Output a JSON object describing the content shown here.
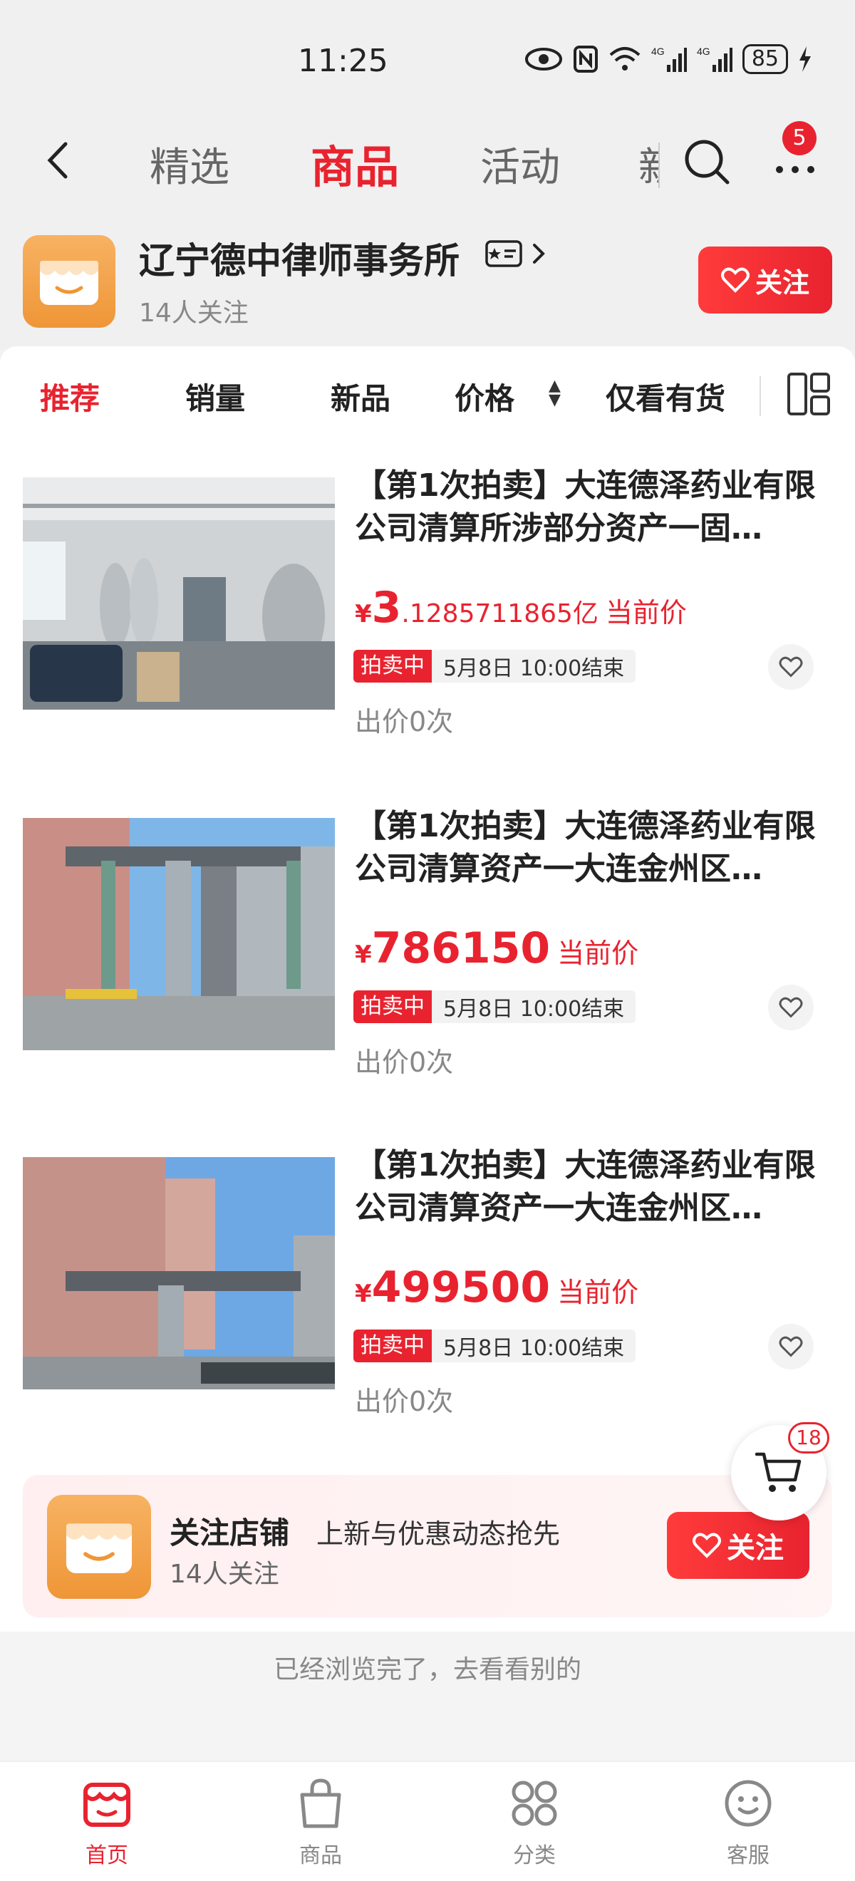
{
  "status_bar": {
    "time": "11:25",
    "battery": "85"
  },
  "top_nav": {
    "tabs": [
      {
        "label": "精选"
      },
      {
        "label": "商品"
      },
      {
        "label": "活动"
      },
      {
        "label": "新"
      }
    ],
    "more_badge": "5"
  },
  "shop": {
    "name": "辽宁德中律师事务所",
    "followers": "14人关注",
    "follow_label": "关注"
  },
  "filters": {
    "items": [
      "推荐",
      "销量",
      "新品",
      "价格",
      "仅看有货"
    ]
  },
  "products": [
    {
      "title": "【第1次拍卖】大连德泽药业有限公司清算所涉部分资产一固…",
      "price_symbol": "¥",
      "price_main": "3",
      "price_rest": ".1285711865亿",
      "price_label": "当前价",
      "status_tag": "拍卖中",
      "end_time": "5月8日 10:00结束",
      "bids": "出价0次"
    },
    {
      "title": "【第1次拍卖】大连德泽药业有限公司清算资产一大连金州区…",
      "price_symbol": "¥",
      "price_main": "786150",
      "price_rest": "",
      "price_label": "当前价",
      "status_tag": "拍卖中",
      "end_time": "5月8日 10:00结束",
      "bids": "出价0次"
    },
    {
      "title": "【第1次拍卖】大连德泽药业有限公司清算资产一大连金州区…",
      "price_symbol": "¥",
      "price_main": "499500",
      "price_rest": "",
      "price_label": "当前价",
      "status_tag": "拍卖中",
      "end_time": "5月8日 10:00结束",
      "bids": "出价0次"
    }
  ],
  "cart": {
    "badge": "18"
  },
  "follow_banner": {
    "title": "关注店铺",
    "subtitle": "上新与优惠动态抢先",
    "followers": "14人关注",
    "button": "关注"
  },
  "end_text": "已经浏览完了，去看看别的",
  "bottom_tabs": [
    {
      "label": "首页"
    },
    {
      "label": "商品"
    },
    {
      "label": "分类"
    },
    {
      "label": "客服"
    }
  ],
  "colors": {
    "accent": "#e8232f",
    "shop_logo": "#f0a045"
  }
}
